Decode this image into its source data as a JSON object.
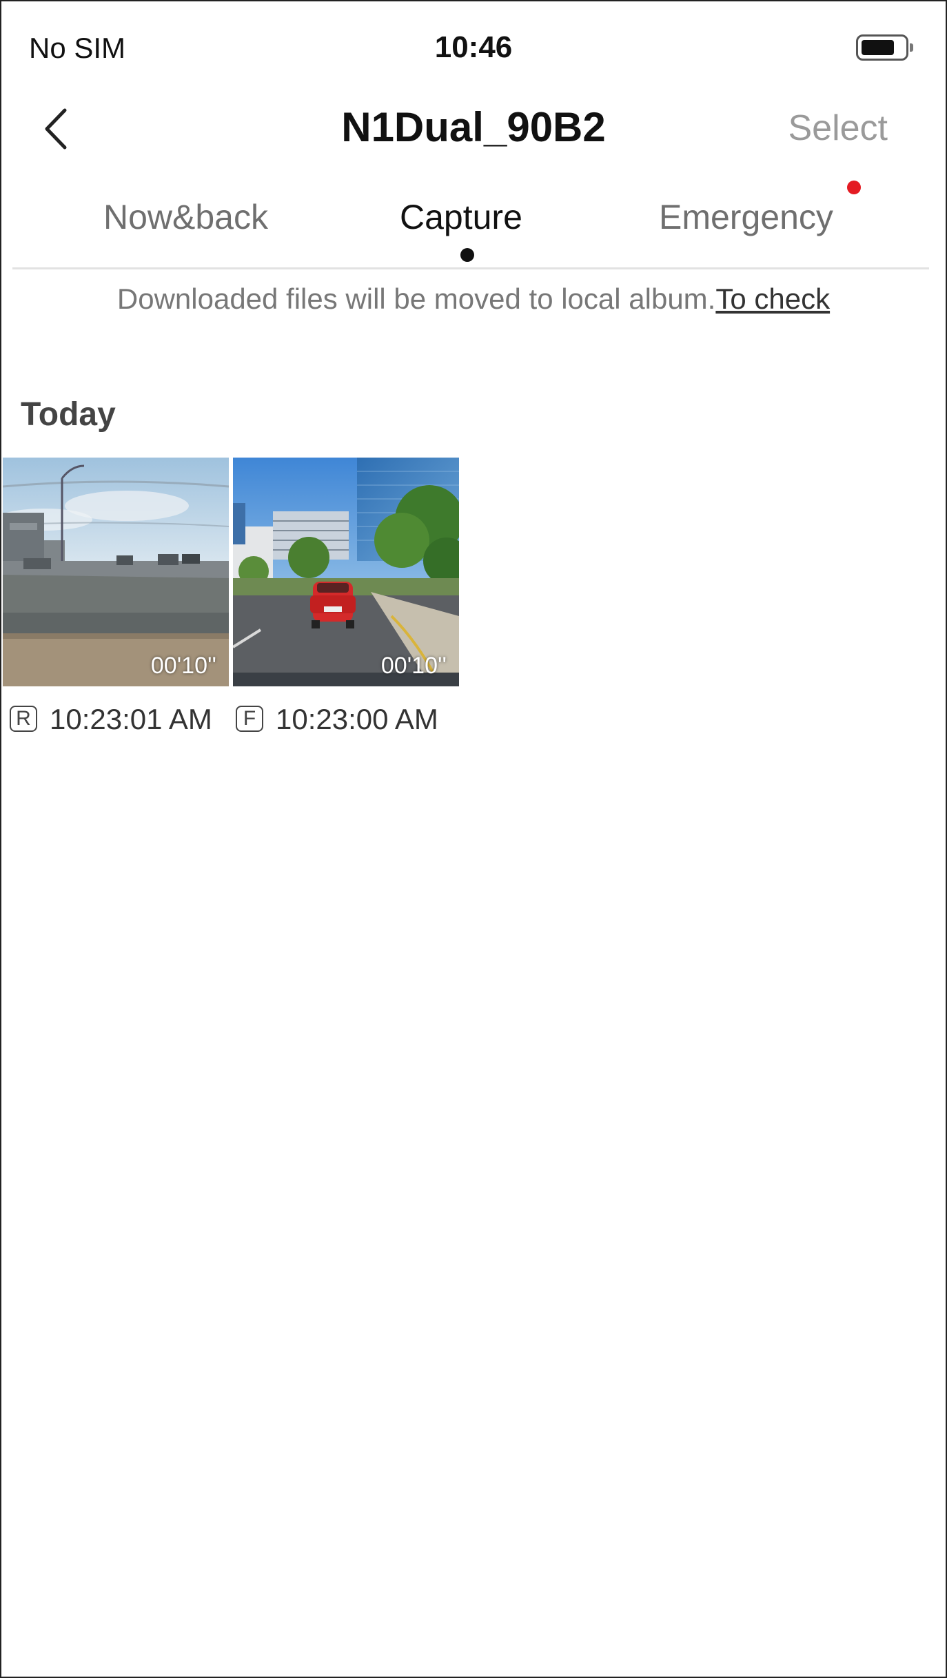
{
  "status_bar": {
    "carrier": "No SIM",
    "time": "10:46",
    "battery_level": 0.75
  },
  "nav": {
    "back_icon": "chevron-left-icon",
    "title": "N1Dual_90B2",
    "select_label": "Select"
  },
  "tabs": [
    {
      "label": "Now&back",
      "active": false
    },
    {
      "label": "Capture",
      "active": true
    },
    {
      "label": "Emergency",
      "active": false,
      "notification": true
    }
  ],
  "notice": {
    "text": "Downloaded files will be moved to local album.",
    "link": "To check"
  },
  "sections": [
    {
      "title": "Today",
      "items": [
        {
          "camera": "R",
          "time": "10:23:01 AM",
          "duration": "00'10''"
        },
        {
          "camera": "F",
          "time": "10:23:00 AM",
          "duration": "00'10''"
        }
      ]
    }
  ],
  "colors": {
    "notification_dot": "#e41b23",
    "inactive_text": "#6f6f6f",
    "active_text": "#111111"
  }
}
